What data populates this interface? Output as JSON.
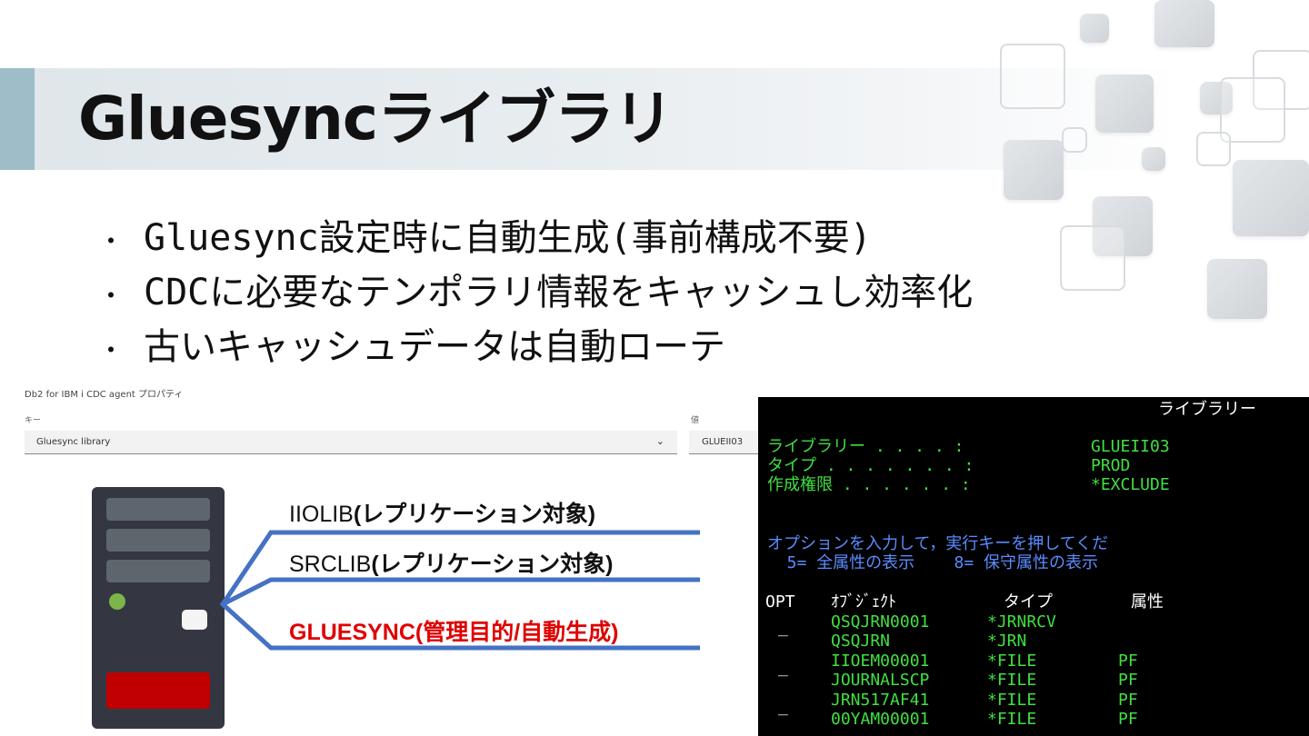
{
  "slide": {
    "title": "Gluesyncライブラリ",
    "bullets": [
      "Gluesync設定時に自動生成(事前構成不要)",
      "CDCに必要なテンポラリ情報をキャッシュし効率化",
      "古いキャッシュデータは自動ローテ"
    ]
  },
  "properties_panel": {
    "title": "Db2 for IBM i CDC agent プロパティ",
    "key_label": "キー",
    "key_value": "Gluesync library",
    "value_label": "値",
    "value_value": "GLUEII03"
  },
  "diagram": {
    "libraries": [
      {
        "name": "IIOLIB",
        "note": "(レプリケーション対象)"
      },
      {
        "name": "SRCLIB",
        "note": "(レプリケーション対象)"
      },
      {
        "name": "GLUESYNC(管理目的/自動生成)",
        "note": ""
      }
    ]
  },
  "terminal": {
    "header": "ライブラリー",
    "fields": [
      {
        "label": "ライブラリー . . . . :",
        "value": "GLUEII03"
      },
      {
        "label": "タイプ . . . . . . . :",
        "value": "PROD"
      },
      {
        "label": "作成権限 . . . . . . :",
        "value": "*EXCLUDE"
      }
    ],
    "instruction": "オプションを入力して，実行キーを押してくだ",
    "options": "  5= 全属性の表示    8= 保守属性の表示",
    "columns": {
      "opt": "OPT",
      "object": "ｵﾌﾞｼﾞｪｸﾄ",
      "type": "タイプ",
      "attr": "属性"
    },
    "rows": [
      {
        "opt": "_",
        "object": "QSQJRN0001",
        "type": "*JRNRCV",
        "attr": ""
      },
      {
        "opt": "",
        "object": "QSQJRN",
        "type": "*JRN",
        "attr": ""
      },
      {
        "opt": "_",
        "object": "IIOEM00001",
        "type": "*FILE",
        "attr": "PF"
      },
      {
        "opt": "",
        "object": "JOURNALSCP",
        "type": "*FILE",
        "attr": "PF"
      },
      {
        "opt": "_",
        "object": "JRN517AF41",
        "type": "*FILE",
        "attr": "PF"
      },
      {
        "opt": "",
        "object": "00YAM00001",
        "type": "*FILE",
        "attr": "PF"
      }
    ]
  },
  "colors": {
    "accent_bar": "#9fbcc9",
    "connector_blue": "#4472c4",
    "server_body": "#343741",
    "server_red": "#c00000",
    "terminal_green": "#40e040",
    "terminal_blue": "#5a8cff",
    "gluesync_label": "#e00000"
  }
}
